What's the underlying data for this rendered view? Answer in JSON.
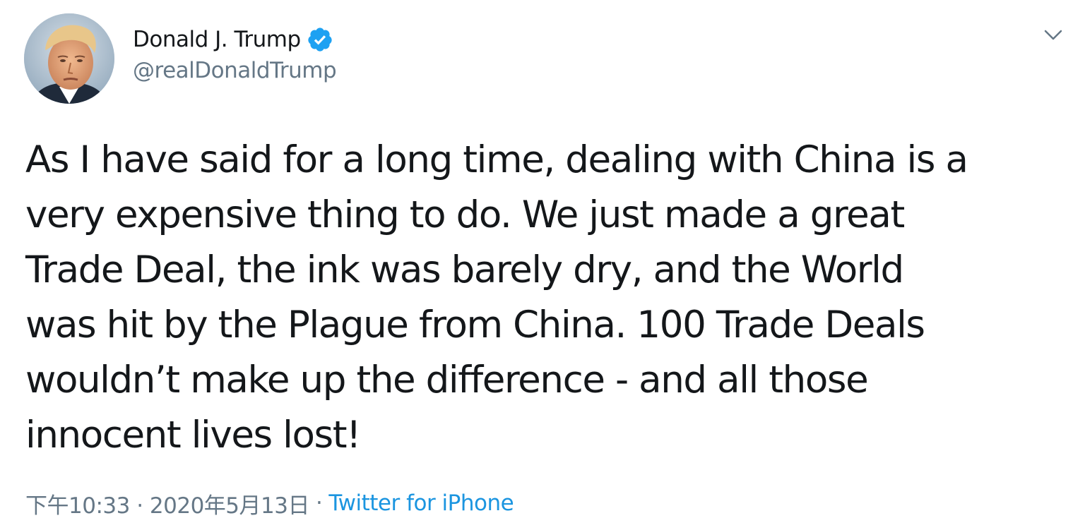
{
  "colors": {
    "text_primary": "#14171a",
    "text_secondary": "#657786",
    "link": "#1b95e0",
    "verified_badge": "#1da1f2"
  },
  "author": {
    "display_name": "Donald J. Trump",
    "handle": "@realDonaldTrump",
    "verified": true,
    "avatar_icon": "profile-photo"
  },
  "tweet": {
    "text": "As I have said for a long time, dealing with China is a\nvery expensive thing to do. We just made a great\nTrade Deal, the ink was barely dry, and the World\nwas hit by the Plague from China. 100 Trade Deals\nwouldn’t make up the difference - and all those\ninnocent lives lost!"
  },
  "meta": {
    "timestamp": "下午10:33 · 2020年5月13日",
    "separator": "·",
    "source": "Twitter for iPhone"
  },
  "menu": {
    "icon": "chevron-down-icon"
  }
}
